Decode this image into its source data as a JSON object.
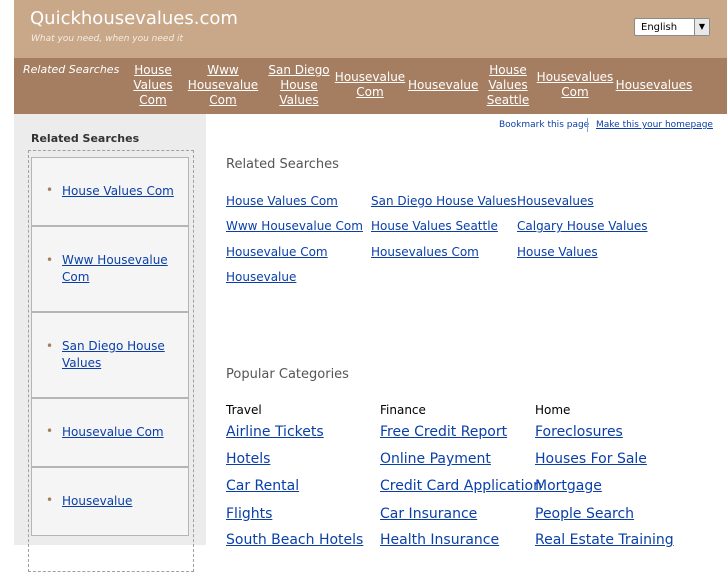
{
  "header": {
    "title": "Quickhousevalues.com",
    "tagline": "What you need, when you need it",
    "language": "English",
    "dropdown_arrow": "▼"
  },
  "nav": {
    "label": "Related Searches",
    "links": [
      "House Values Com",
      "Www Housevalue Com",
      "San Diego House Values",
      "Housevalue Com",
      "Housevalue",
      "House Values Seattle",
      "Housevalues Com",
      "Housevalues"
    ]
  },
  "sidebar": {
    "title": "Related Searches",
    "bullet": "•",
    "items": [
      "House Values Com",
      "Www Housevalue Com",
      "San Diego House Values",
      "Housevalue Com",
      "Housevalue"
    ]
  },
  "toplinks": {
    "bookmark": "Bookmark this page",
    "homepage": "Make this your homepage"
  },
  "related": {
    "title": "Related Searches",
    "links": [
      "House Values Com",
      "San Diego House Values",
      "Housevalues",
      "Www Housevalue Com",
      "House Values Seattle",
      "Calgary House Values",
      "Housevalue Com",
      "Housevalues Com",
      "House Values",
      "Housevalue"
    ]
  },
  "popular": {
    "title": "Popular Categories",
    "columns": [
      {
        "heading": "Travel",
        "links": [
          "Airline Tickets",
          "Hotels",
          "Car Rental",
          "Flights",
          "South Beach Hotels"
        ]
      },
      {
        "heading": "Finance",
        "links": [
          "Free Credit Report",
          "Online Payment",
          "Credit Card Application",
          "Car Insurance",
          "Health Insurance"
        ]
      },
      {
        "heading": "Home",
        "links": [
          "Foreclosures",
          "Houses For Sale",
          "Mortgage",
          "People Search",
          "Real Estate Training"
        ]
      }
    ]
  }
}
